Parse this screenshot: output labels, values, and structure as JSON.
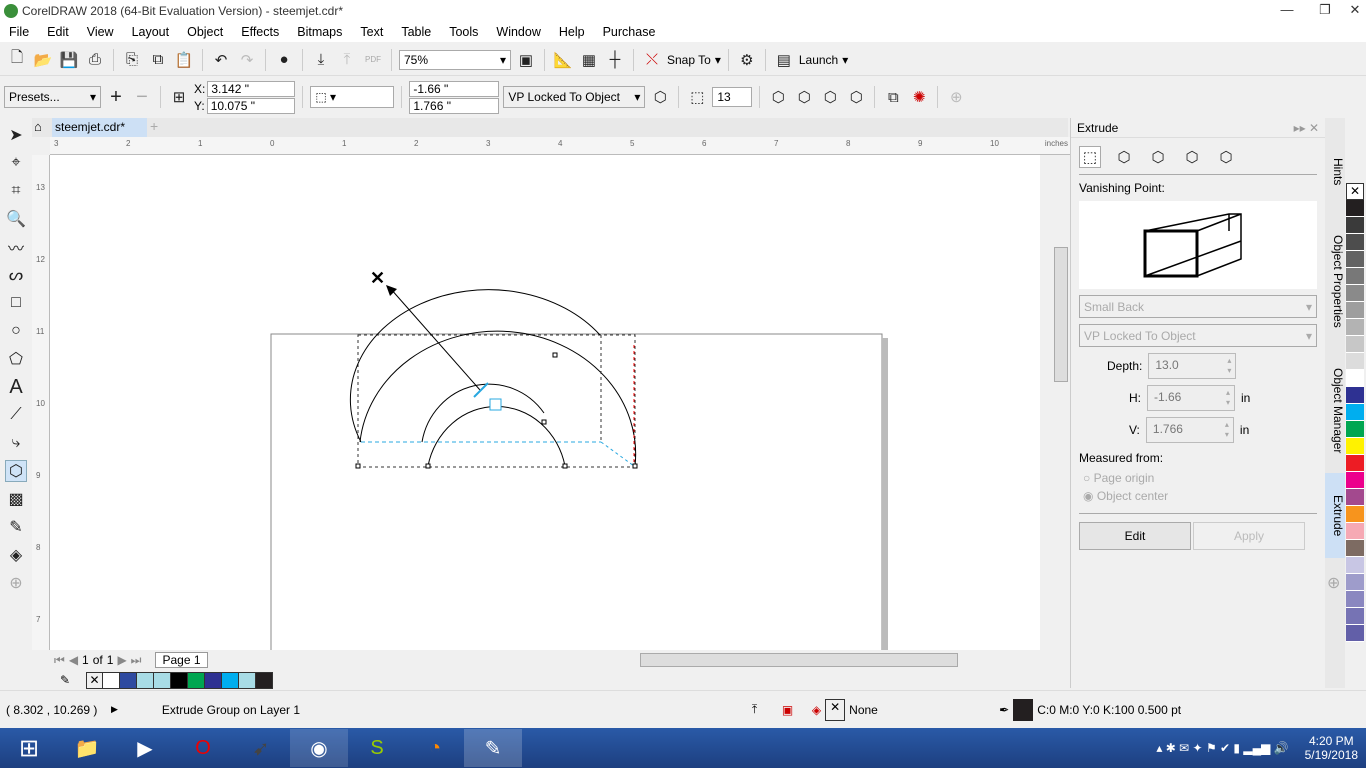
{
  "window": {
    "title": "CorelDRAW 2018 (64-Bit Evaluation Version) - steemjet.cdr*"
  },
  "menu": [
    "File",
    "Edit",
    "View",
    "Layout",
    "Object",
    "Effects",
    "Bitmaps",
    "Text",
    "Table",
    "Tools",
    "Window",
    "Help",
    "Purchase"
  ],
  "toolbar": {
    "zoom": "75%",
    "snap_to": "Snap To",
    "launch": "Launch",
    "pdf": "PDF"
  },
  "propbar": {
    "presets": "Presets...",
    "x_label": "X:",
    "x": "3.142 \"",
    "y_label": "Y:",
    "y": "10.075 \"",
    "h": "-1.66 \"",
    "v": "1.766 \"",
    "vp_mode": "VP Locked To Object",
    "depth": "13"
  },
  "doc_tab": "steemjet.cdr*",
  "ruler": {
    "top": [
      "3",
      "2",
      "1",
      "0",
      "1",
      "2",
      "3",
      "4",
      "5",
      "6",
      "7",
      "8",
      "9",
      "10"
    ],
    "unit": "inches",
    "left": [
      "13",
      "12",
      "11",
      "10",
      "9",
      "8",
      "7"
    ]
  },
  "docker": {
    "title": "Extrude",
    "vanishing_point_label": "Vanishing Point:",
    "extrusion_type": "Small Back",
    "vp_mode": "VP Locked To Object",
    "depth_label": "Depth:",
    "depth": "13.0",
    "h_label": "H:",
    "h": "-1.66",
    "v_label": "V:",
    "v": "1.766",
    "unit": "in",
    "measured_from": "Measured from:",
    "radio_page_origin": "Page origin",
    "radio_object_center": "Object center",
    "selected_radio": "Object center",
    "edit": "Edit",
    "apply": "Apply"
  },
  "side_tabs": [
    "Hints",
    "Object Properties",
    "Object Manager",
    "Extrude"
  ],
  "active_side_tab": "Extrude",
  "palette": [
    "#231f20",
    "#3a3a3a",
    "#4d4d4d",
    "#636363",
    "#787878",
    "#8a8a8a",
    "#9e9e9e",
    "#b3b3b3",
    "#c7c7c7",
    "#dcdcdc",
    "#ffffff",
    "#2e3192",
    "#00aeef",
    "#00a651",
    "#fff200",
    "#ed1c24",
    "#ec008c",
    "#a3498e",
    "#f7941d",
    "#f6a9b4",
    "#7d6b62",
    "#c8c6e4",
    "#9e9ccb",
    "#8a87c0",
    "#7673b4",
    "#625fa8"
  ],
  "doc_palette": [
    "#ffffff",
    "#2e4aa0",
    "#a8dce6",
    "#a8dce6",
    "#000000",
    "#00a651",
    "#2e3192",
    "#00aeef",
    "#a8dce6",
    "#231f20"
  ],
  "pagenav": {
    "current": "1",
    "of": "of",
    "total": "1",
    "page_tab": "Page 1"
  },
  "status": {
    "coords": "( 8.302 , 10.269 )",
    "info": "Extrude Group on Layer 1",
    "fill": "None",
    "outline": "C:0 M:0 Y:0 K:100  0.500 pt"
  },
  "taskbar": {
    "time": "4:20 PM",
    "date": "5/19/2018"
  }
}
